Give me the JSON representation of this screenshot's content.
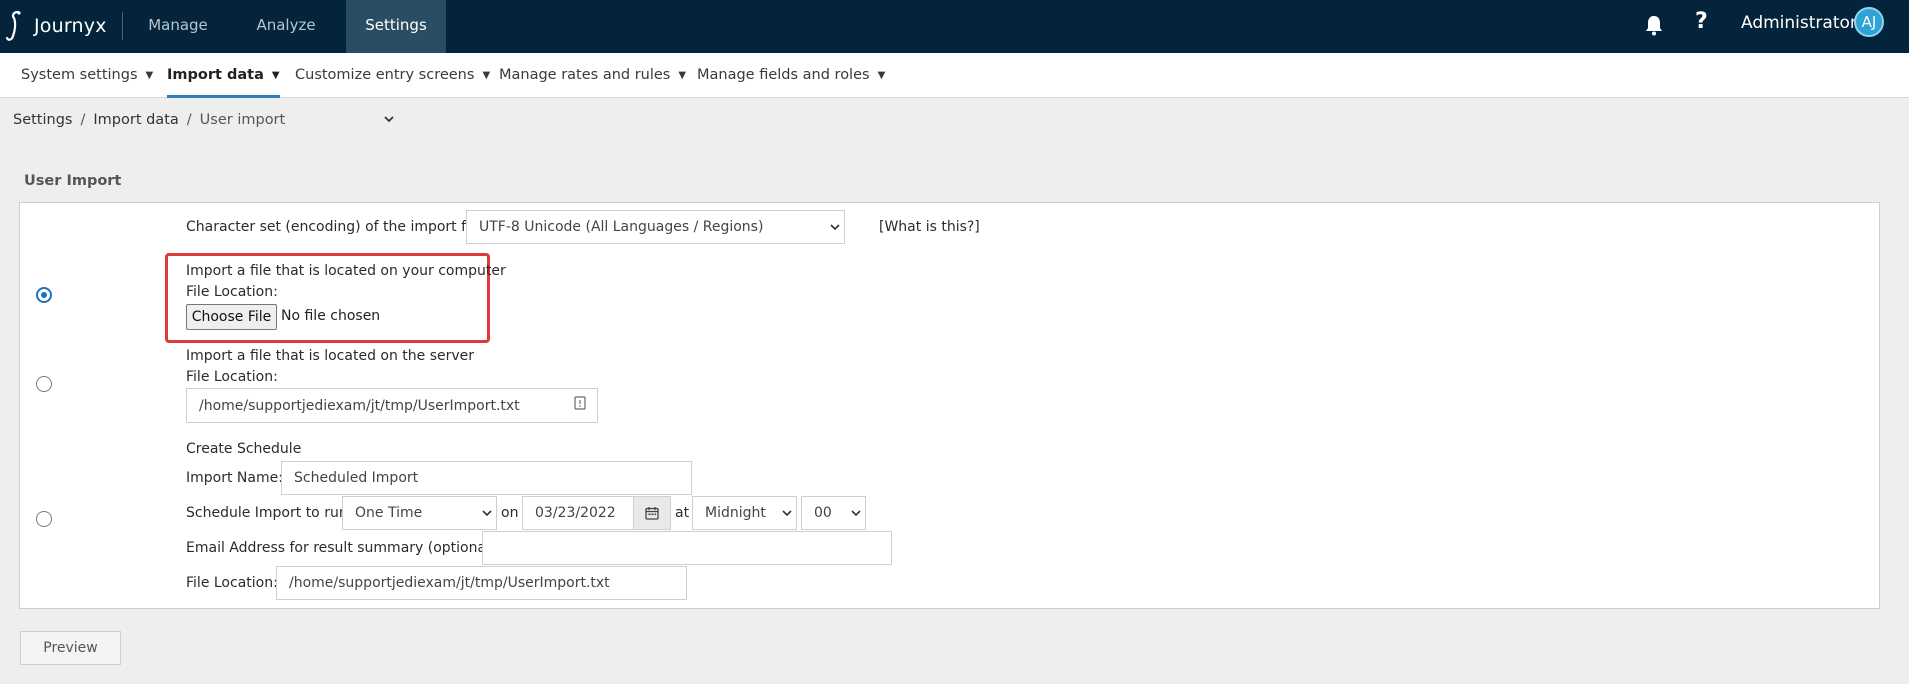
{
  "app": {
    "name": "Journyx"
  },
  "topnav": [
    {
      "label": "Manage",
      "active": false
    },
    {
      "label": "Analyze",
      "active": false
    },
    {
      "label": "Settings",
      "active": true
    }
  ],
  "user": {
    "name": "Administrator",
    "initials": "AJ"
  },
  "icons": {
    "notifications": "bell-icon",
    "help": "question-icon",
    "dropdown": "caret-down-icon",
    "calendar": "calendar-icon"
  },
  "subnav": [
    {
      "label": "System settings",
      "active": false
    },
    {
      "label": "Import data",
      "active": true
    },
    {
      "label": "Customize entry screens",
      "active": false
    },
    {
      "label": "Manage rates and rules",
      "active": false
    },
    {
      "label": "Manage fields and roles",
      "active": false
    }
  ],
  "breadcrumb": {
    "items": [
      "Settings",
      "Import data"
    ],
    "current": "User import"
  },
  "page": {
    "section_title": "User Import"
  },
  "encoding": {
    "label": "Character set (encoding) of the import file:",
    "selected": "UTF-8 Unicode (All Languages / Regions)",
    "help_link": "[What is this?]"
  },
  "local_import": {
    "title": "Import a file that is located on your computer",
    "file_location_label": "File Location:",
    "choose_file_label": "Choose File",
    "file_status": "No file chosen",
    "selected": true
  },
  "server_import": {
    "title": "Import a file that is located on the server",
    "file_location_label": "File Location:",
    "path": "/home/supportjediexam/jt/tmp/UserImport.txt",
    "selected": false
  },
  "schedule": {
    "title": "Create Schedule",
    "import_name_label": "Import Name:",
    "import_name_value": "Scheduled Import",
    "run_label": "Schedule Import to run",
    "frequency": "One Time",
    "on_label": "on",
    "date": "03/23/2022",
    "at_label": "at",
    "hour": "Midnight",
    "minute": "00",
    "email_label": "Email Address for result summary (optional):",
    "email_value": "",
    "file_location_label": "File Location:",
    "path": "/home/supportjediexam/jt/tmp/UserImport.txt",
    "selected": false
  },
  "actions": {
    "preview_label": "Preview"
  },
  "colors": {
    "topbar": "#03243a",
    "active_tab": "#2a4d64",
    "accent": "#2f7fb8",
    "highlight": "#de3a3a",
    "avatar": "#2fa3d6"
  }
}
